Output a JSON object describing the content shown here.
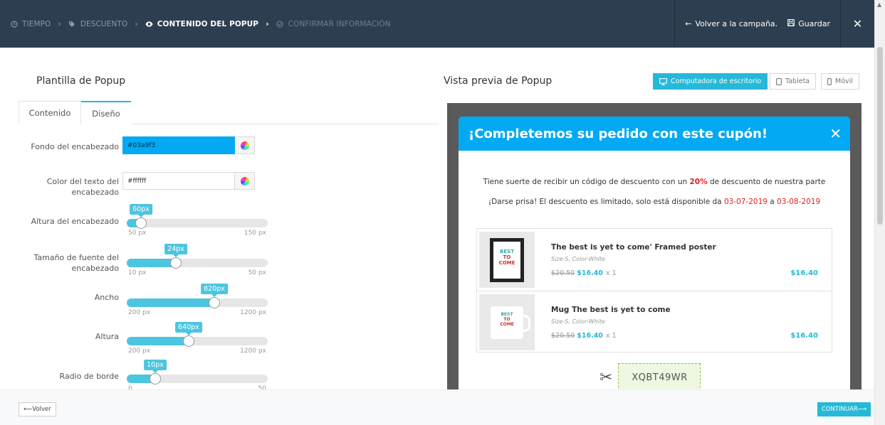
{
  "steps": [
    {
      "label": "TIEMPO",
      "icon": "clock-icon"
    },
    {
      "label": "DESCUENTO",
      "icon": "tag-icon"
    },
    {
      "label": "CONTENIDO DEL POPUP",
      "icon": "eye-icon"
    },
    {
      "label": "CONFIRMAR INFORMACIÓN",
      "icon": "check-circle-icon"
    }
  ],
  "header": {
    "back_to_campaign": "Volver a la campaña.",
    "save": "Guardar"
  },
  "left": {
    "title": "Plantilla de Popup",
    "tab_content": "Contenido",
    "tab_design": "Diseño",
    "header_bg_label": "Fondo del encabezado",
    "header_bg_value": "#03a9f3",
    "header_text_color_label": "Color del texto del encabezado",
    "header_text_color_value": "#ffffff",
    "sliders": [
      {
        "label": "Altura del encabezado",
        "bubble": "60px",
        "min_label": "50 px",
        "max_label": "150 px",
        "fraction": 0.1
      },
      {
        "label": "Tamaño de fuente del encabezado",
        "bubble": "24px",
        "min_label": "10 px",
        "max_label": "50 px",
        "fraction": 0.35
      },
      {
        "label": "Ancho",
        "bubble": "820px",
        "min_label": "200 px",
        "max_label": "1200 px",
        "fraction": 0.62
      },
      {
        "label": "Altura",
        "bubble": "640px",
        "min_label": "200 px",
        "max_label": "1200 px",
        "fraction": 0.44
      },
      {
        "label": "Radio de borde",
        "bubble": "10px",
        "min_label": "0",
        "max_label": "50",
        "fraction": 0.2
      }
    ]
  },
  "right": {
    "title": "Vista previa de Popup",
    "device_desktop": "Computadora de escritorio",
    "device_tablet": "Tableta",
    "device_mobile": "Móvil"
  },
  "popup": {
    "header_color": "#03a9f3",
    "title": "¡Completemos su pedido con este cupón!",
    "text1_prefix": "Tiene suerte de recibir un código de descuento con un ",
    "text1_percent": "20%",
    "text1_suffix": " de descuento de nuestra parte",
    "text2_prefix": "¡Darse prisa! El descuento es limitado, solo está disponible da ",
    "text2_from": "03-07-2019",
    "text2_mid": " a ",
    "text2_to": "03-08-2019",
    "products": [
      {
        "name": "The best is yet to come' Framed poster",
        "attrs": "Size-S, Color-White",
        "old_price": "$20.50",
        "new_price": "$16.40",
        "qty": "x 1",
        "total": "$16.40"
      },
      {
        "name": "Mug The best is yet to come",
        "attrs": "Size-S, Color-White",
        "old_price": "$20.50",
        "new_price": "$16.40",
        "qty": "x 1",
        "total": "$16.40"
      }
    ],
    "coupon_code": "XQBT49WR"
  },
  "footer": {
    "back": "Volver",
    "continue": "CONTINUAR"
  }
}
